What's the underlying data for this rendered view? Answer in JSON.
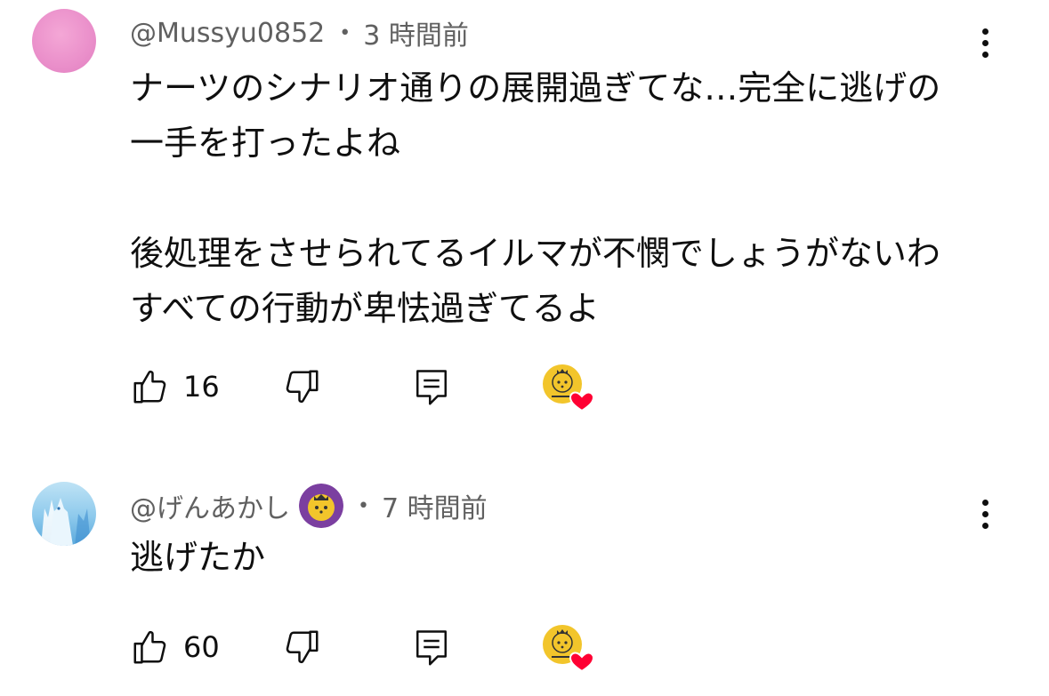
{
  "comments": [
    {
      "username": "@Mussyu0852",
      "time": "3 時間前",
      "separator": "•",
      "text": "ナーツのシナリオ通りの展開過ぎてな…完全に逃げの\n一手を打ったよね\n\n後処理をさせられてるイルマが不憫でしょうがないわ\nすべての行動が卑怯過ぎてるよ",
      "likes": "16",
      "avatar_color": "#ea8fca",
      "has_member_badge": false,
      "creator_hearted": true
    },
    {
      "username": "@げんあかし",
      "time": "7 時間前",
      "separator": "•",
      "text": "逃げたか",
      "likes": "60",
      "avatar_color": "#8dc9ec",
      "has_member_badge": true,
      "creator_hearted": true
    }
  ],
  "icons": {
    "like": "thumbs-up-icon",
    "dislike": "thumbs-down-icon",
    "reply": "reply-icon",
    "more": "more-vertical-icon",
    "creator_heart": "creator-heart-icon"
  },
  "colors": {
    "heart": "#ff0033",
    "creator_avatar": "#f2c52b",
    "member_badge": "#7b3fa0"
  }
}
